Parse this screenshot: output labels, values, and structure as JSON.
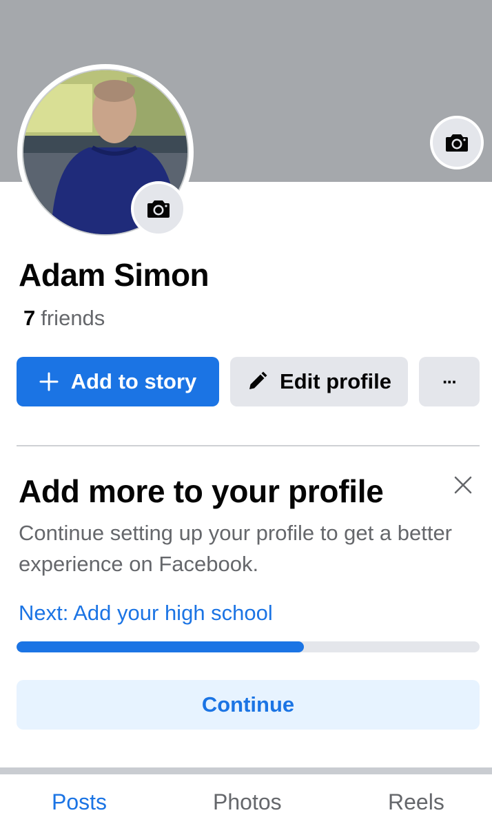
{
  "profile": {
    "name": "Adam Simon",
    "friends_count": "7",
    "friends_label": "friends"
  },
  "actions": {
    "add_story_label": "Add to story",
    "edit_profile_label": "Edit profile",
    "more_label": "···"
  },
  "card": {
    "title": "Add more to your profile",
    "description": "Continue setting up your profile to get a better experience on Facebook.",
    "next_link": "Next: Add your high school",
    "progress": 0.62,
    "continue_label": "Continue"
  },
  "tabs": [
    {
      "label": "Posts",
      "active": true
    },
    {
      "label": "Photos",
      "active": false
    },
    {
      "label": "Reels",
      "active": false
    }
  ],
  "colors": {
    "accent": "#1b74e4",
    "cover": "#a5a8ac",
    "secondary_button": "#e4e6eb",
    "continue_bg": "#e7f3ff"
  },
  "icons": {
    "cover_camera": "camera-icon",
    "avatar_camera": "camera-icon",
    "add_story": "plus-icon",
    "edit_profile": "pencil-icon",
    "close": "close-icon"
  }
}
